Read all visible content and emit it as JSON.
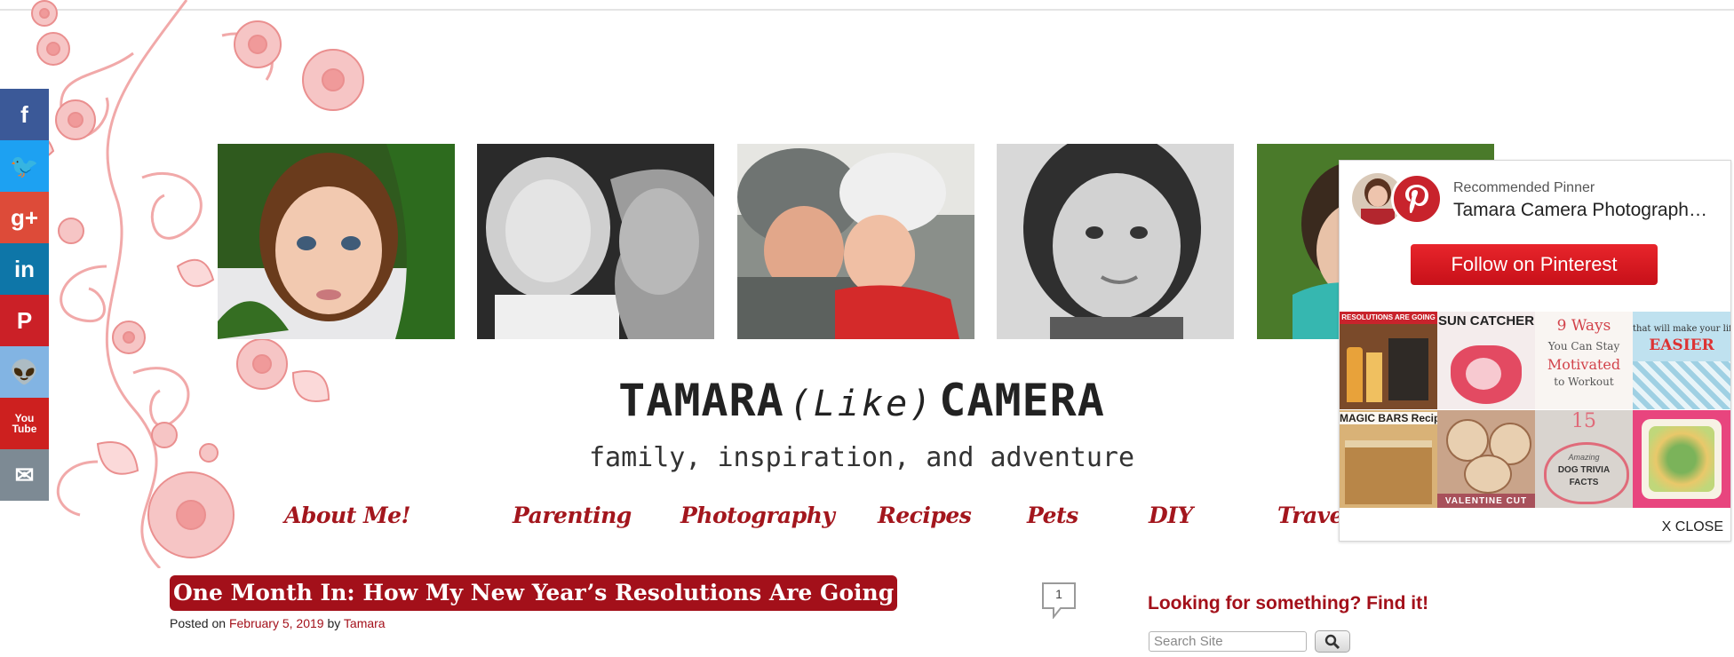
{
  "site": {
    "title_part1": "TAMARA",
    "title_like": "(Like)",
    "title_part2": "CAMERA",
    "tagline": "family, inspiration, and adventure"
  },
  "share_bar": [
    {
      "name": "facebook",
      "glyph": "f",
      "color": "#3b5998"
    },
    {
      "name": "twitter",
      "glyph": "🐦",
      "color": "#1da1f2"
    },
    {
      "name": "google-plus",
      "glyph": "g+",
      "color": "#dd4b39"
    },
    {
      "name": "linkedin",
      "glyph": "in",
      "color": "#0e76a8"
    },
    {
      "name": "pinterest",
      "glyph": "P",
      "color": "#cb2027"
    },
    {
      "name": "reddit",
      "glyph": "👽",
      "color": "#82b4e3"
    },
    {
      "name": "youtube",
      "glyph": "You Tube",
      "color": "#cd201f"
    },
    {
      "name": "email",
      "glyph": "✉",
      "color": "#7d8a94"
    }
  ],
  "nav": [
    {
      "label": "About Me!"
    },
    {
      "label": "Parenting"
    },
    {
      "label": "Photography"
    },
    {
      "label": "Recipes"
    },
    {
      "label": "Pets"
    },
    {
      "label": "DIY"
    },
    {
      "label": "Travel"
    }
  ],
  "post": {
    "title": "One Month In: How My New Year’s Resolutions Are Going",
    "posted_on_label": "Posted on",
    "date": "February 5, 2019",
    "by_label": "by",
    "author": "Tamara",
    "comment_count": "1"
  },
  "sidebar": {
    "search_heading": "Looking for something? Find it!",
    "search_placeholder": "Search Site"
  },
  "pinterest_widget": {
    "recommended_label": "Recommended Pinner",
    "pinner_name": "Tamara Camera Photograph…",
    "follow_label": "Follow on Pinterest",
    "close_label": "X CLOSE",
    "tiles": [
      {
        "caption": "RESOLUTIONS ARE GOING"
      },
      {
        "caption": "SUN CATCHER"
      },
      {
        "caption": "9 Ways",
        "line2": "You Can Stay",
        "line3": "Motivated",
        "line4": "to Workout"
      },
      {
        "caption": "that will make your life",
        "line2": "EASIER"
      },
      {
        "caption": "MAGIC BARS Recipe"
      },
      {
        "caption": "VALENTINE CUT"
      },
      {
        "caption": "15",
        "line2": "Amazing",
        "line3": "DOG TRIVIA",
        "line4": "FACTS"
      },
      {
        "caption": ""
      }
    ]
  },
  "colors": {
    "brand_red": "#a3101a",
    "floral_pink": "#f0a4a4",
    "pinterest_red": "#e60023"
  }
}
